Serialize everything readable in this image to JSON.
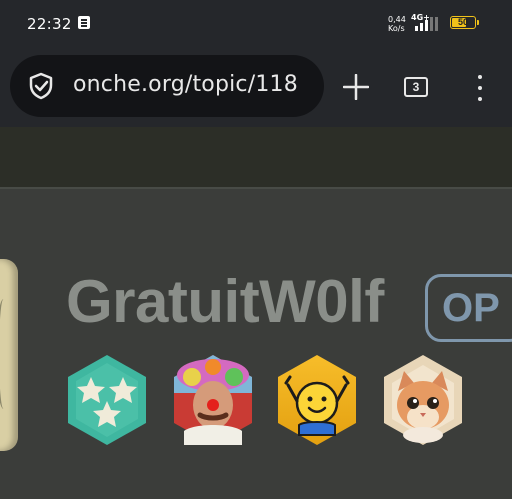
{
  "status_bar": {
    "time": "22:32",
    "net_speed_value": "0,44",
    "net_speed_unit": "Ko/s",
    "network_type": "4G+",
    "battery_level": "50"
  },
  "browser": {
    "url": "onche.org/topic/118",
    "tab_count": "3"
  },
  "profile": {
    "username": "GratuitW0lf",
    "op_label": "OP",
    "badges": [
      "stars-badge",
      "clown-badge",
      "happy-emoji-badge",
      "cat-badge"
    ]
  },
  "colors": {
    "toolbar_bg": "#25272b",
    "url_bar_bg": "#131417",
    "page_bg": "#3b3d3a",
    "username": "#8a8e89",
    "op_badge": "#7f97ac",
    "battery": "#f0c21a"
  }
}
